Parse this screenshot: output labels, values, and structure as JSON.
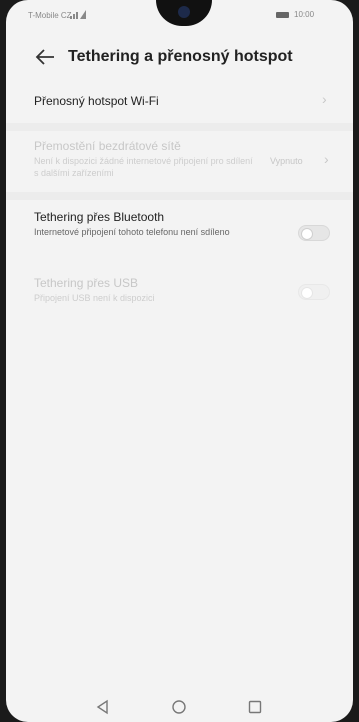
{
  "status": {
    "carrier": "T-Mobile CZ",
    "time": "10:00"
  },
  "header": {
    "title": "Tethering a přenosný hotspot",
    "back_icon": "arrow-left-icon"
  },
  "items": [
    {
      "label": "Přenosný hotspot Wi-Fi",
      "enabled": true
    },
    {
      "label": "Přemostění bezdrátové sítě",
      "sub": "Není k dispozici žádné internetové připojení pro sdílení s dalšími zařízeními",
      "value": "Vypnuto",
      "enabled": false
    },
    {
      "label": "Tethering přes Bluetooth",
      "sub": "Internetové připojení tohoto telefonu není sdíleno",
      "on": false,
      "enabled": true
    },
    {
      "label": "Tethering přes USB",
      "sub": "Připojení USB není k dispozici",
      "on": false,
      "enabled": false
    }
  ],
  "navbar": {
    "icons": [
      "back-triangle-icon",
      "home-circle-icon",
      "recents-square-icon"
    ]
  }
}
